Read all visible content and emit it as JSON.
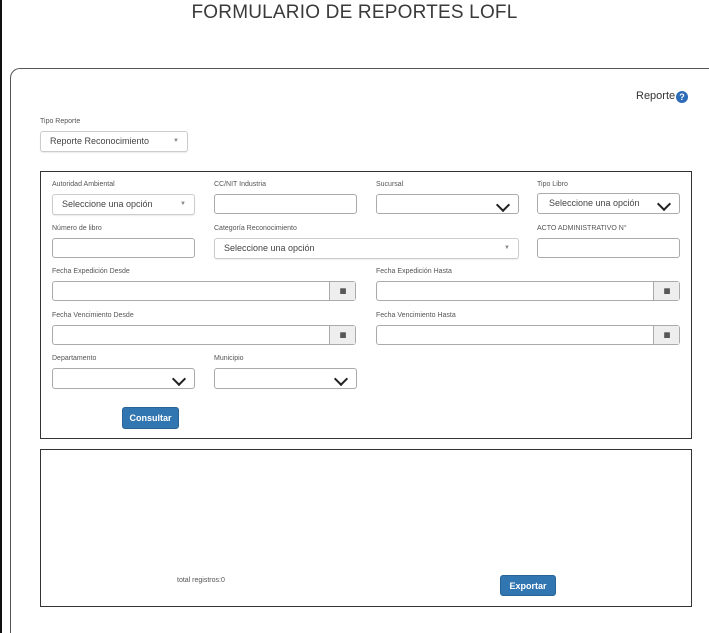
{
  "header": {
    "title": "FORMULARIO DE REPORTES LOFL"
  },
  "help": {
    "label": "Reporte",
    "icon": "question-circle-icon",
    "icon_glyph": "?"
  },
  "tipo_reporte": {
    "label": "Tipo Reporte",
    "value": "Reporte Reconocimiento",
    "caret": "▼"
  },
  "filters": {
    "autoridad_ambiental": {
      "label": "Autoridad Ambiental",
      "value": "Seleccione una opción",
      "caret": "▼"
    },
    "cc_nit_industria": {
      "label": "CC/NIT Industria",
      "value": ""
    },
    "sucursal": {
      "label": "Sucursal",
      "value": ""
    },
    "tipo_libro": {
      "label": "Tipo Libro",
      "value": "Seleccione una opción"
    },
    "numero_libro": {
      "label": "Número de libro",
      "value": ""
    },
    "categoria_reconocimiento": {
      "label": "Categoría Reconocimiento",
      "value": "Seleccione una opción",
      "caret": "▼"
    },
    "acto_administrativo": {
      "label": "ACTO ADMINISTRATIVO N°",
      "value": ""
    },
    "fecha_expedicion_desde": {
      "label": "Fecha Expedición Desde",
      "value": ""
    },
    "fecha_expedicion_hasta": {
      "label": "Fecha Expedición Hasta",
      "value": ""
    },
    "fecha_vencimiento_desde": {
      "label": "Fecha Vencimiento Desde",
      "value": ""
    },
    "fecha_vencimiento_hasta": {
      "label": "Fecha Vencimiento Hasta",
      "value": ""
    },
    "departamento": {
      "label": "Departamento",
      "value": ""
    },
    "municipio": {
      "label": "Municipio",
      "value": ""
    },
    "calendar_glyph": "▦"
  },
  "actions": {
    "consultar_label": "Consultar",
    "exportar_label": "Exportar"
  },
  "results": {
    "total_text": "total registros:0"
  },
  "colors": {
    "primary": "#3276b1",
    "help_icon": "#2d6cb8"
  }
}
